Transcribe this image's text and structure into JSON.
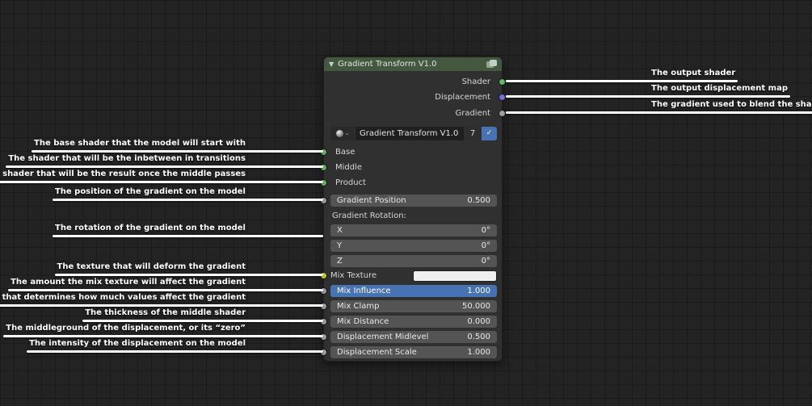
{
  "colors": {
    "canvas_bg": "#232323",
    "grid_line": "#1b1b1b",
    "node_body": "#303030",
    "node_header": "#43583f",
    "field_bg": "#545454",
    "selected_field_bg": "#4772b3",
    "socket_shader": "#63b763",
    "socket_vector": "#7272d8",
    "socket_value": "#a0a0a0",
    "socket_color": "#c9c936",
    "annotation": "#ffffff"
  },
  "icons": {
    "collapse": "▼",
    "chevron_down": "⌄",
    "check": "✓"
  },
  "node": {
    "title": "Gradient Transform V1.0",
    "outputs": [
      {
        "label": "Shader"
      },
      {
        "label": "Displacement"
      },
      {
        "label": "Gradient"
      }
    ],
    "group": {
      "name": "Gradient Transform V1.0",
      "user_count": "7"
    },
    "inputs": [
      {
        "label": "Base"
      },
      {
        "label": "Middle"
      },
      {
        "label": "Product"
      }
    ],
    "fields": {
      "gradient_position": {
        "label": "Gradient Position",
        "value": "0.500"
      },
      "rotation_heading": "Gradient Rotation:",
      "rot_x": {
        "label": "X",
        "value": "0°"
      },
      "rot_y": {
        "label": "Y",
        "value": "0°"
      },
      "rot_z": {
        "label": "Z",
        "value": "0°"
      },
      "mix_texture_label": "Mix Texture",
      "mix_influence": {
        "label": "Mix Influence",
        "value": "1.000"
      },
      "mix_clamp": {
        "label": "Mix Clamp",
        "value": "50.000"
      },
      "mix_distance": {
        "label": "Mix Distance",
        "value": "0.000"
      },
      "disp_midlevel": {
        "label": "Displacement Midlevel",
        "value": "0.500"
      },
      "disp_scale": {
        "label": "Displacement Scale",
        "value": "1.000"
      }
    }
  },
  "annotations": {
    "right": [
      {
        "label": "The output shader"
      },
      {
        "label": "The output displacement map"
      },
      {
        "label": "The gradient used to blend the shaders"
      }
    ],
    "left": [
      {
        "label": "The base shader that the model will start with"
      },
      {
        "label": "The shader that will be the inbetween in transitions"
      },
      {
        "label": "The shader that will be the result once the middle passes"
      },
      {
        "label": "The position of the gradient on the model"
      },
      {
        "label": "The rotation of the gradient on the model"
      },
      {
        "label": "The texture that will deform the gradient"
      },
      {
        "label": "The amount the mix texture will affect the gradient"
      },
      {
        "label": "The clamp that determines how much values affect the gradient"
      },
      {
        "label": "The thickness of the middle shader"
      },
      {
        "label": "The middleground of the displacement, or its “zero”"
      },
      {
        "label": "The intensity of the displacement on the model"
      }
    ]
  }
}
